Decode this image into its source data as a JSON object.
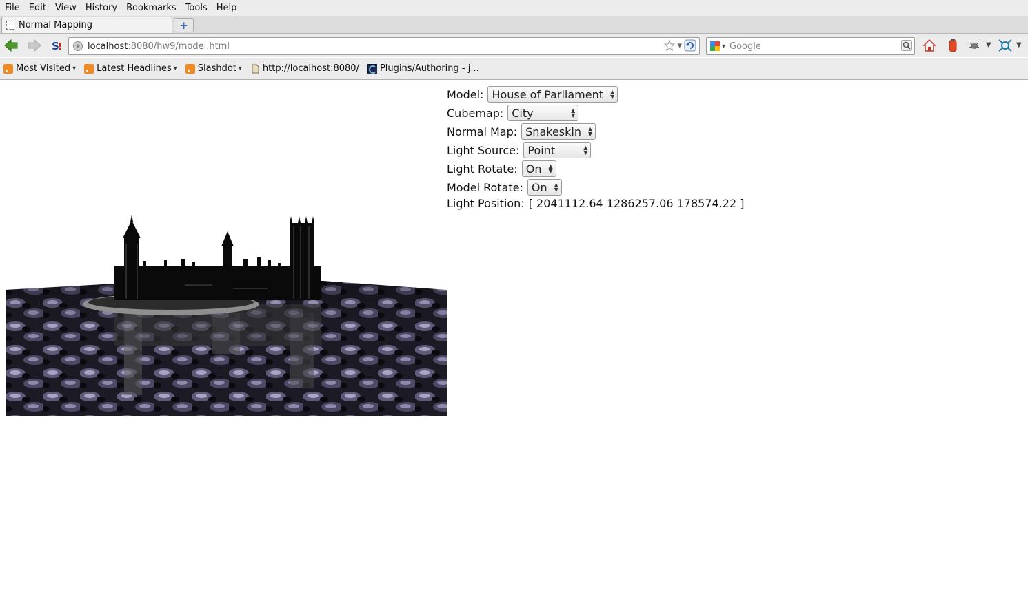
{
  "menu": [
    "File",
    "Edit",
    "View",
    "History",
    "Bookmarks",
    "Tools",
    "Help"
  ],
  "tab": {
    "title": "Normal Mapping",
    "new_tab_glyph": "+"
  },
  "url": {
    "host": "localhost",
    "rest": ":8080/hw9/model.html"
  },
  "search": {
    "placeholder": "Google"
  },
  "bookmarks": [
    {
      "label": "Most Visited",
      "icon": "rss-folder-icon",
      "caret": "▾"
    },
    {
      "label": "Latest Headlines",
      "icon": "rss-icon",
      "caret": "▾"
    },
    {
      "label": "Slashdot",
      "icon": "rss-icon",
      "caret": "▾"
    },
    {
      "label": "http://localhost:8080/",
      "icon": "page-icon",
      "caret": ""
    },
    {
      "label": "Plugins/Authoring - j...",
      "icon": "site-icon",
      "caret": ""
    }
  ],
  "controls": {
    "model_label": "Model:",
    "model_value": "House of Parliament",
    "cubemap_label": "Cubemap:",
    "cubemap_value": "City",
    "normal_label": "Normal Map:",
    "normal_value": "Snakeskin",
    "light_label": "Light Source:",
    "light_value": "Point",
    "light_rotate_label": "Light Rotate:",
    "light_rotate_value": "On",
    "model_rotate_label": "Model Rotate:",
    "model_rotate_value": "On",
    "position_label": "Light Position:",
    "position_value": "[ 2041112.64 1286257.06 178574.22 ]"
  },
  "colors": {
    "water": "#4a4660",
    "water_light": "#8c87a6",
    "building": "#0a0a0a"
  }
}
